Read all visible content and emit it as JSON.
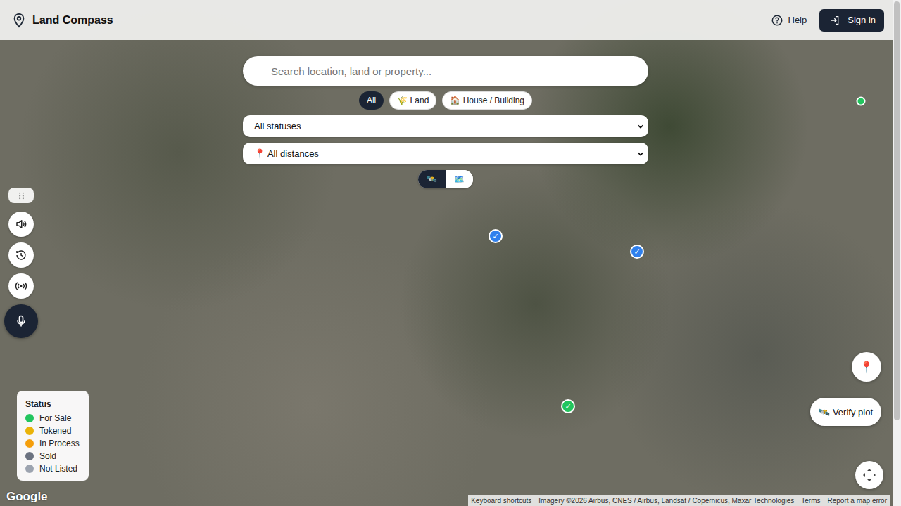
{
  "header": {
    "brand": "Land Compass",
    "help": "Help",
    "sign_in": "Sign in"
  },
  "search": {
    "placeholder": "Search location, land or property..."
  },
  "type_filters": [
    {
      "label": "All",
      "selected": true
    },
    {
      "label": "🌾 Land",
      "selected": false
    },
    {
      "label": "🏠 House / Building",
      "selected": false
    }
  ],
  "status_select": "All statuses",
  "distance_select": "📍 All distances",
  "map_type_toggle": [
    {
      "label": "🛰️",
      "selected": true
    },
    {
      "label": "🗺️",
      "selected": false
    }
  ],
  "pin_mark": "✓",
  "pins": [
    {
      "color": "#22c55e",
      "verified": false
    },
    {
      "color": "#2f80ed",
      "verified": true
    },
    {
      "color": "#2f80ed",
      "verified": true
    },
    {
      "color": "#22c55e",
      "verified": true
    }
  ],
  "legend": {
    "title": "Status",
    "items": [
      {
        "label": "For Sale",
        "color": "#22c55e"
      },
      {
        "label": "Tokened",
        "color": "#eab308"
      },
      {
        "label": "In Process",
        "color": "#f59e0b"
      },
      {
        "label": "Sold",
        "color": "#6b7280"
      },
      {
        "label": "Not Listed",
        "color": "#9ca3af"
      }
    ]
  },
  "locate_button": "📍",
  "verify_button": "🛰️ Verify plot",
  "footer": {
    "logo": "Google",
    "links": [
      "Keyboard shortcuts",
      "Imagery ©2026 Airbus, CNES / Airbus, Landsat / Copernicus, Maxar Technologies",
      "Terms",
      "Report a map error"
    ]
  }
}
